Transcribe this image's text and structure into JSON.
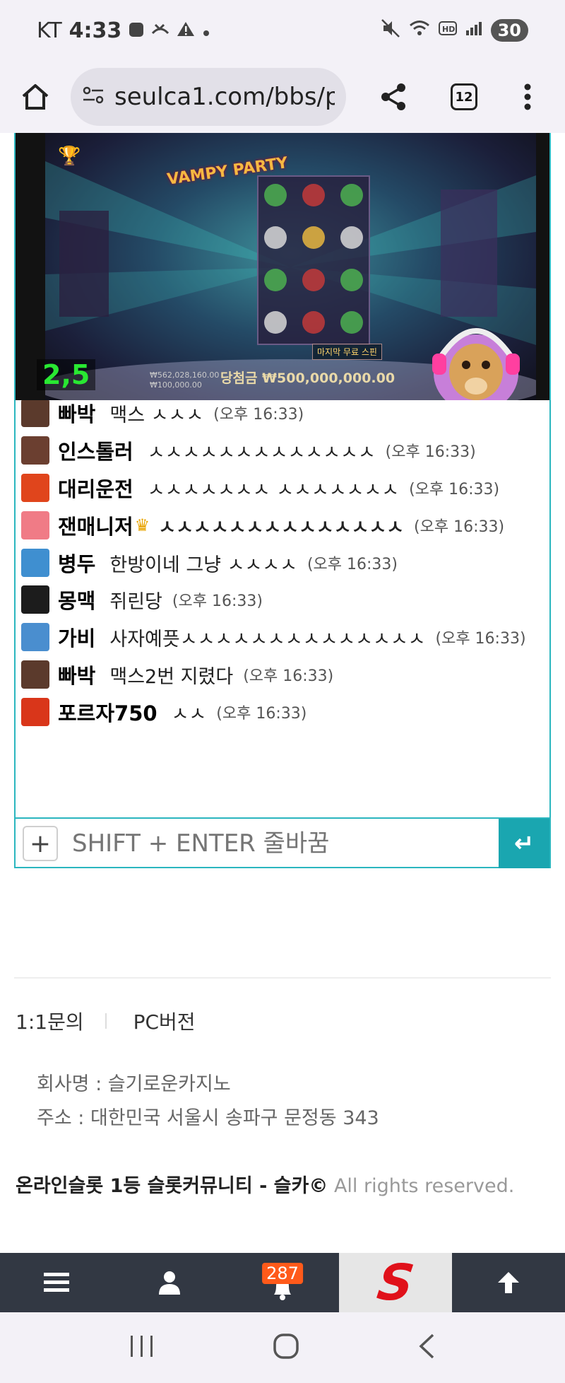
{
  "status_bar": {
    "carrier": "KT",
    "time": "4:33",
    "battery": "30"
  },
  "browser": {
    "url": "seulca1.com/bbs/p",
    "tab_count": "12"
  },
  "video": {
    "game_title": "VAMPY PARTY",
    "win_text": "당첨금 ₩500,000,000.00",
    "balance_lines": [
      "₩562,028,160.00",
      "₩100,000.00"
    ],
    "free_spin_label": "마지막 무료 스핀",
    "multiplier": "2,5"
  },
  "chat": {
    "messages": [
      {
        "nick": "빠박",
        "text": "맥스 ㅅㅅㅅ",
        "time": "(오후 16:33)",
        "avatar_color": "#5b3a2c",
        "crown": false
      },
      {
        "nick": "인스톨러",
        "text": "ㅅㅅㅅㅅㅅㅅㅅㅅㅅㅅㅅㅅㅅ",
        "time": "(오후 16:33)",
        "avatar_color": "#6b3f30",
        "crown": false
      },
      {
        "nick": "대리운전",
        "text": "ㅅㅅㅅㅅㅅㅅㅅ ㅅㅅㅅㅅㅅㅅㅅ",
        "time": "(오후 16:33)",
        "avatar_color": "#e0451c",
        "crown": false
      },
      {
        "nick": "잰매니저",
        "text": "ㅅㅅㅅㅅㅅㅅㅅㅅㅅㅅㅅㅅㅅㅅ",
        "time": "(오후 16:33)",
        "avatar_color": "#f07b86",
        "crown": true
      },
      {
        "nick": "병두",
        "text": "한방이네 그냥 ㅅㅅㅅㅅ",
        "time": "(오후 16:33)",
        "avatar_color": "#3f8fd0",
        "crown": false
      },
      {
        "nick": "몽맥",
        "text": "쥐린당",
        "time": "(오후 16:33)",
        "avatar_color": "#1c1c1c",
        "crown": false
      },
      {
        "nick": "가비",
        "text": "사자예픗ㅅㅅㅅㅅㅅㅅㅅㅅㅅㅅㅅㅅㅅㅅ",
        "time": "(오후 16:33)",
        "avatar_color": "#4a8ecf",
        "crown": false
      },
      {
        "nick": "빠박",
        "text": "맥스2번 지렸다",
        "time": "(오후 16:33)",
        "avatar_color": "#5b3a2c",
        "crown": false
      },
      {
        "nick": "포르자750",
        "text": "ㅅㅅ",
        "time": "(오후 16:33)",
        "avatar_color": "#d9361a",
        "crown": false
      }
    ],
    "input_placeholder": "SHIFT + ENTER 줄바꿈",
    "plus_label": "+",
    "send_label": "↵"
  },
  "footer": {
    "links": [
      "1:1문의",
      "PC버전"
    ],
    "company_name": "회사명 : 슬기로운카지노",
    "address": "주소 : 대한민국 서울시 송파구 문정동 343",
    "copyright_bold": "온라인슬롯 1등 슬롯커뮤니티 - 슬카©",
    "copyright_rest": " All rights reserved."
  },
  "bottom_nav": {
    "notification_count": "287",
    "logo_letter": "S"
  },
  "colors": {
    "accent": "#1aa6b0",
    "nav_bg": "#323843",
    "badge": "#ff5a1a",
    "logo": "#e0111a"
  }
}
